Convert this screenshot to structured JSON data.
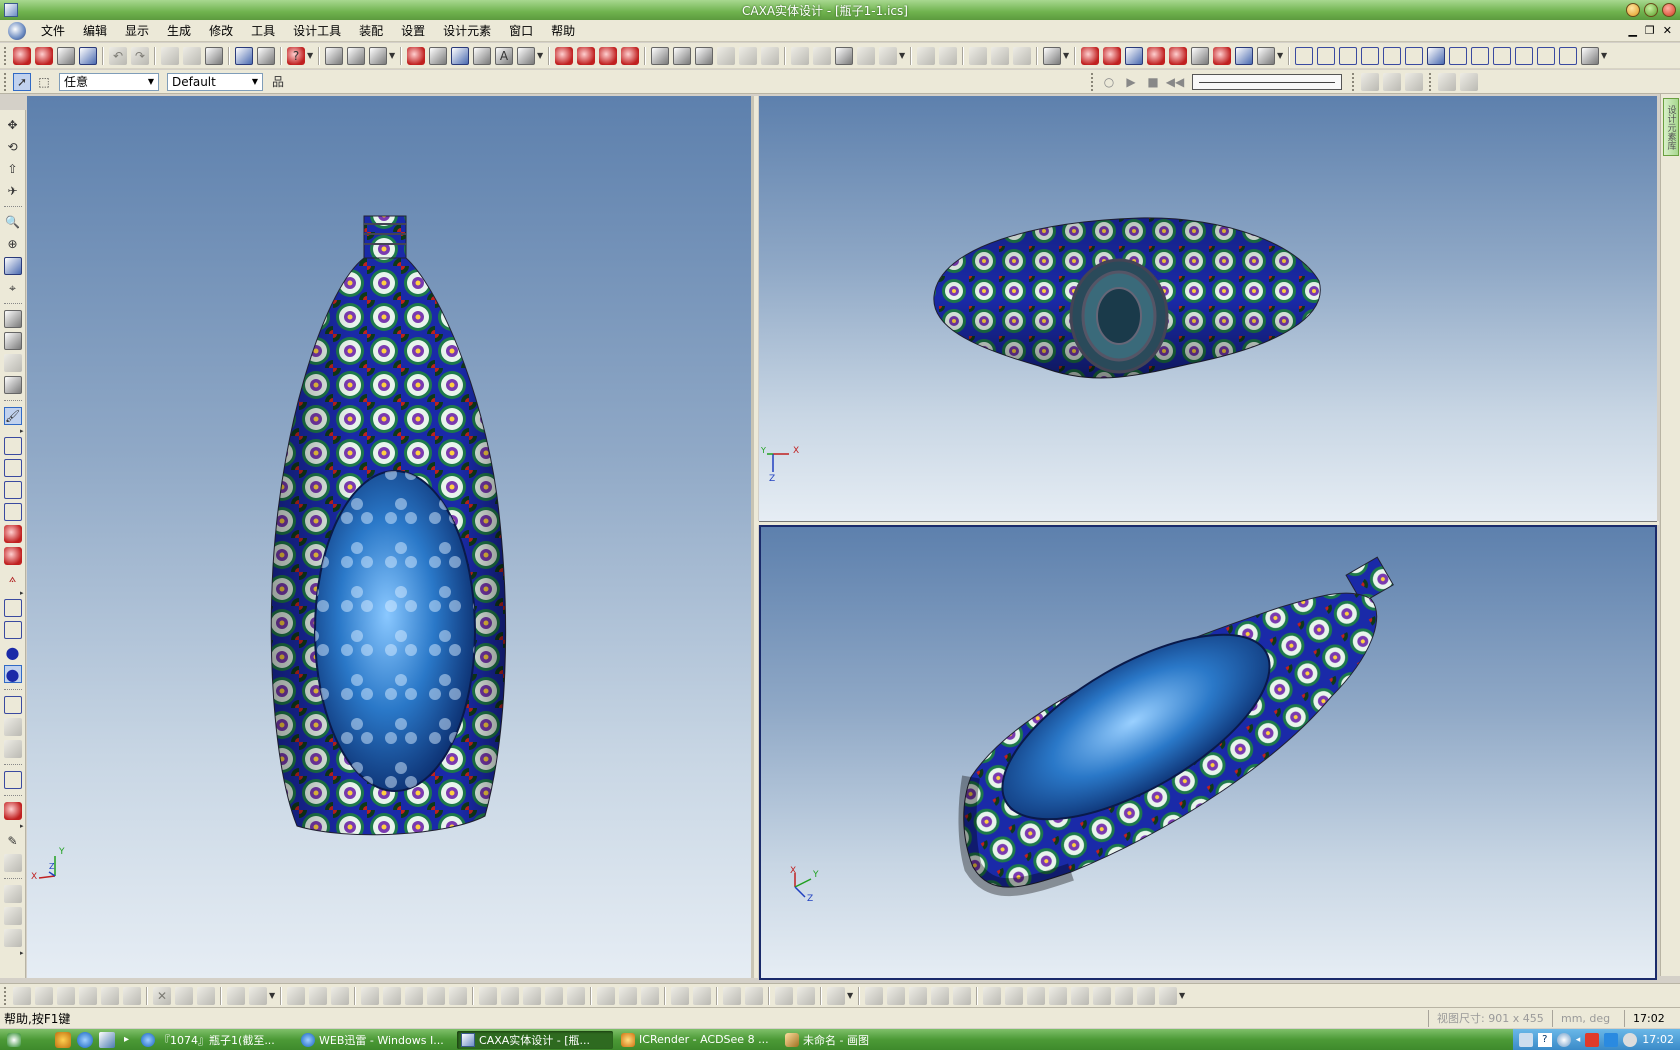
{
  "window": {
    "title": "CAXA实体设计 - [瓶子1-1.ics]"
  },
  "menu": {
    "items": [
      "文件",
      "编辑",
      "显示",
      "生成",
      "修改",
      "工具",
      "设计工具",
      "装配",
      "设置",
      "设计元素",
      "窗口",
      "帮助"
    ]
  },
  "toolbar2": {
    "selection_filter": "任意",
    "style": "Default"
  },
  "right_panel": {
    "tab_label": "设计元素库"
  },
  "viewports": {
    "main": {
      "axis_x": "X",
      "axis_y": "Y",
      "axis_z": "Z"
    },
    "top": {
      "axis_x": "X",
      "axis_y": "Y",
      "axis_z": "Z"
    },
    "bottom": {
      "axis_x": "X",
      "axis_y": "Y",
      "axis_z": "Z"
    }
  },
  "statusbar": {
    "help": "帮助,按F1键",
    "view_size": "视图尺寸: 901 x 455",
    "units": "mm, deg",
    "time": "17:02"
  },
  "taskbar": {
    "tasks": [
      {
        "label": "『1074』瓶子1(截至...",
        "active": false
      },
      {
        "label": "WEB迅雷 - Windows I...",
        "active": false
      },
      {
        "label": "CAXA实体设计 - [瓶...",
        "active": true
      },
      {
        "label": "ICRender - ACDSee 8 ...",
        "active": false
      },
      {
        "label": "未命名 - 画图",
        "active": false
      }
    ],
    "clock": "17:02"
  },
  "colors": {
    "titlebar": "#6fb24e",
    "viewport_top": "#5d80ad",
    "viewport_bottom": "#e6edf4",
    "bottle_blue": "#1a2aa8",
    "taskbar": "#4c9a36"
  }
}
